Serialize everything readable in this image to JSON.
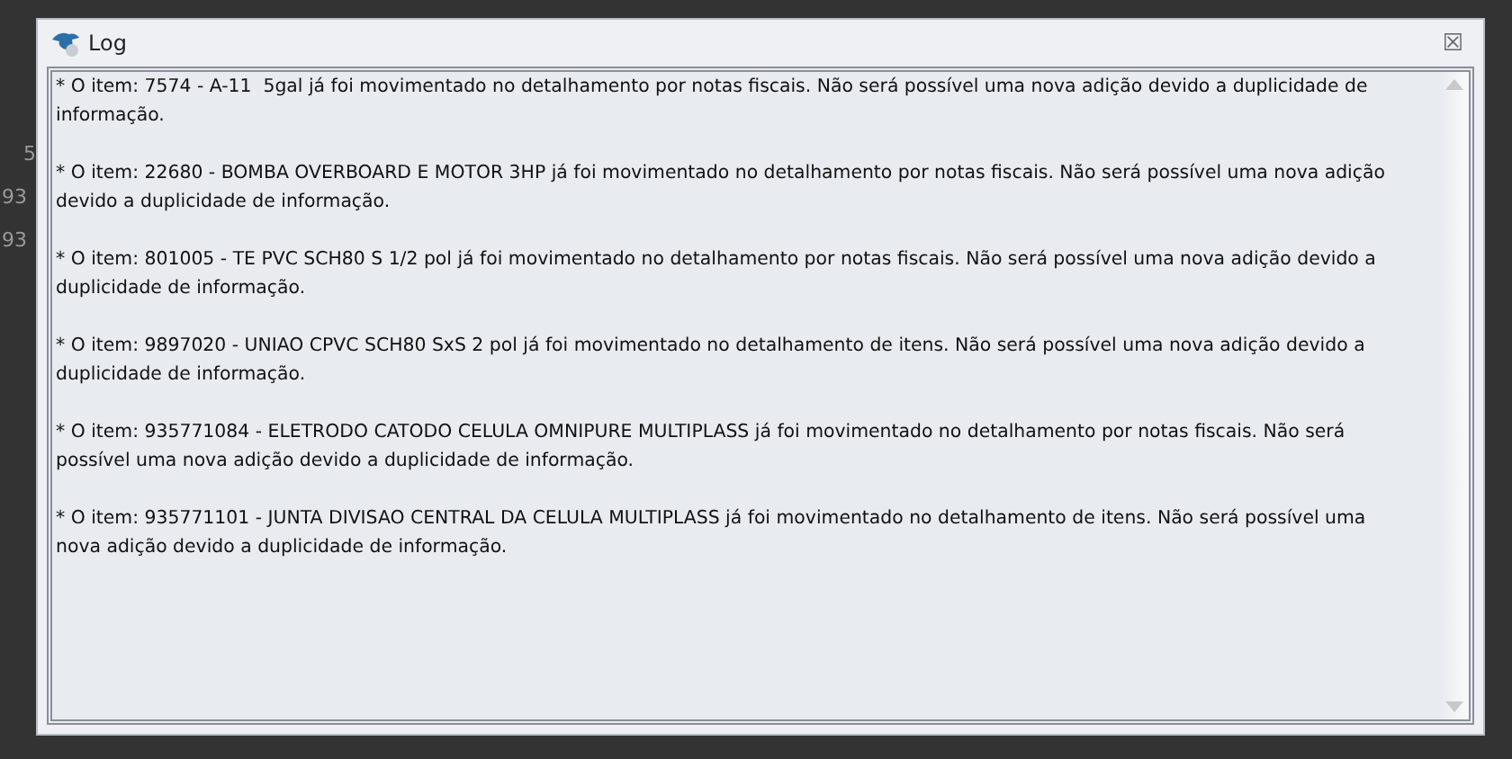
{
  "background": {
    "row_labels": [
      "5",
      "93",
      "93"
    ]
  },
  "window": {
    "title": "Log",
    "close": "☒"
  },
  "log": {
    "messages": [
      "* O item: 7574 - A-11  5gal já foi movimentado no detalhamento por notas fiscais. Não será possível uma nova adição devido a duplicidade de informação.",
      "* O item: 22680 - BOMBA OVERBOARD E MOTOR 3HP já foi movimentado no detalhamento por notas fiscais. Não será possível uma nova adição devido a duplicidade de informação.",
      "* O item: 801005 - TE PVC SCH80 S 1/2 pol já foi movimentado no detalhamento por notas fiscais. Não será possível uma nova adição devido a duplicidade de informação.",
      "* O item: 9897020 - UNIAO CPVC SCH80 SxS 2 pol já foi movimentado no detalhamento de itens. Não será possível uma nova adição devido a duplicidade de informação.",
      "* O item: 935771084 - ELETRODO CATODO CELULA OMNIPURE MULTIPLASS já foi movimentado no detalhamento por notas fiscais. Não será possível uma nova adição devido a duplicidade de informação.",
      "* O item: 935771101 - JUNTA DIVISAO CENTRAL DA CELULA MULTIPLASS já foi movimentado no detalhamento de itens. Não será possível uma nova adição devido a duplicidade de informação."
    ]
  }
}
